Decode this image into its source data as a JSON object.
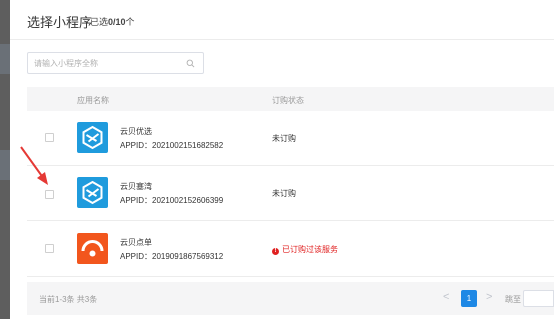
{
  "dialog": {
    "title": "选择小程序",
    "selected_prefix": "已选",
    "selected_value": "0/10",
    "selected_suffix": "个"
  },
  "search": {
    "placeholder": "请输入小程序全称",
    "value": "",
    "icon": "search-icon"
  },
  "table": {
    "columns": [
      "应用名称",
      "订购状态"
    ],
    "rows": [
      {
        "name": "云贝优选",
        "appid": "APPID：2021002151682582",
        "status": "未订购",
        "status_type": "normal",
        "icon": "hexagon-logo-icon",
        "icon_color": "#1f9bdd",
        "checked": false
      },
      {
        "name": "云贝塞湾",
        "appid": "APPID：2021002152606399",
        "status": "未订购",
        "status_type": "normal",
        "icon": "hexagon-logo-icon",
        "icon_color": "#1f9bdd",
        "checked": false
      },
      {
        "name": "云贝点单",
        "appid": "APPID：2019091867569312",
        "status": "已订购过该服务",
        "status_type": "error",
        "icon": "umbrella-logo-icon",
        "icon_color": "#f2561d",
        "checked": false
      }
    ]
  },
  "pagination": {
    "summary": "当前1-3条 共3条",
    "current_page": "1",
    "prev": "<",
    "next": ">",
    "goto_label": "跳至",
    "goto_value": ""
  },
  "colors": {
    "accent": "#1e88e5",
    "error": "#e02020",
    "annotation_arrow": "#e53935"
  }
}
